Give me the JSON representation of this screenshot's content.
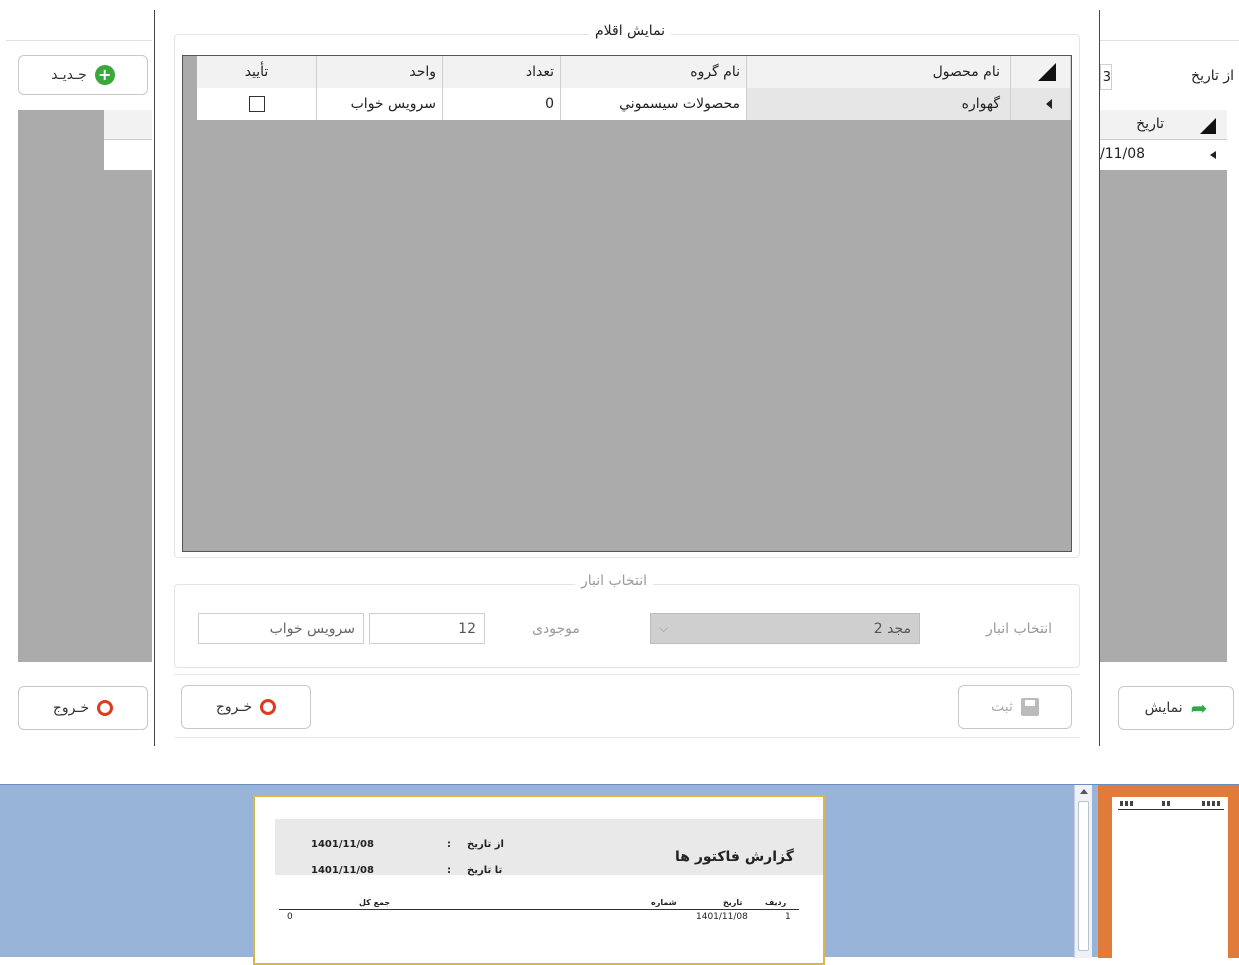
{
  "left_panel": {
    "new_button": "جـديـد",
    "exit_button": "خـروج"
  },
  "right_panel": {
    "from_date_label": "از تاريخ",
    "from_date_value": "3",
    "grid_header_date": "تاريخ",
    "grid_row_date": "/11/08",
    "show_button": "نمايش"
  },
  "dialog": {
    "items_group_title": "نمايش اقلام",
    "columns": [
      "نام محصول",
      "نام گروه",
      "تعداد",
      "واحد",
      "تأييد"
    ],
    "rows": [
      {
        "product": "گهواره",
        "group": "محصولات سيسموني",
        "count": "0",
        "unit": "سرويس خواب",
        "confirmed": false
      }
    ],
    "warehouse_group_title": "انتخاب انبار",
    "warehouse_label": "انتخاب انبار",
    "warehouse_value": "مجد 2",
    "stock_label": "موجودی",
    "stock_value": "12",
    "unit_value": "سرويس خواب",
    "save_button": "ثبت",
    "exit_button": "خـروج"
  },
  "report": {
    "title": "گزارش فاكتور ها",
    "from_label": "از تاريخ",
    "to_label": "تا تاريخ",
    "colon": ":",
    "from_value": "1401/11/08",
    "to_value": "1401/11/08",
    "columns": {
      "row": "رديف",
      "date": "تاريخ",
      "number": "شماره",
      "total": "جمع كل"
    },
    "rows": [
      {
        "row": "1",
        "date": "1401/11/08",
        "total": "0"
      }
    ]
  },
  "colors": {
    "viewer_bg": "#99b4d9",
    "thumb_bg": "#e07b3a",
    "report_border": "#d9b64a",
    "grid_bg": "#ababab"
  }
}
